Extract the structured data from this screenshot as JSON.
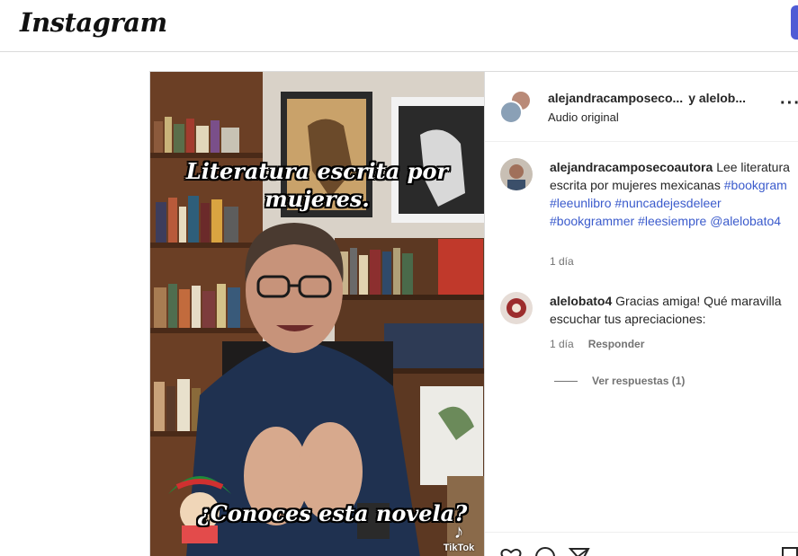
{
  "app": {
    "logo_text": "Instagram"
  },
  "video": {
    "caption_line1": "Literatura escrita por",
    "caption_line2": "mujeres.",
    "caption_bottom": "¿Conoces esta novela?",
    "watermark": "TikTok"
  },
  "header": {
    "user1": "alejandracamposeco...",
    "joiner": "y alelob...",
    "audio": "Audio original",
    "more_icon": "more-options-icon"
  },
  "comments": [
    {
      "user": "alejandracamposecoautora",
      "text_plain": "Lee literatura escrita por mujeres mexicanas",
      "tags": [
        "#bookgram",
        "#leeunlibro",
        "#nuncadejesdeleer",
        "#bookgrammer",
        "#leesiempre",
        "@alelobato4"
      ],
      "time": "1 día"
    },
    {
      "user": "alelobato4",
      "text_plain": "Gracias amiga! Qué maravilla escuchar tus apreciaciones:",
      "time": "1 día",
      "reply_label": "Responder"
    }
  ],
  "view_replies": "Ver respuestas (1)",
  "colors": {
    "link": "#3b5bcc",
    "secondary": "#737373",
    "brand_button": "#4f5bd5"
  }
}
